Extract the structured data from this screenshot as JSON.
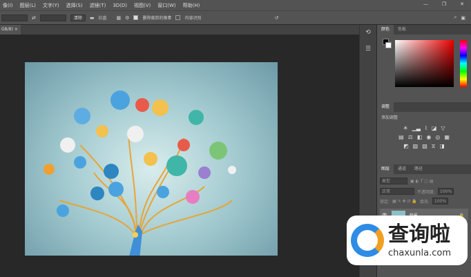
{
  "menu": [
    "像(I)",
    "图层(L)",
    "文字(Y)",
    "选择(S)",
    "滤镜(T)",
    "3D(D)",
    "视图(V)",
    "窗口(W)",
    "帮助(H)"
  ],
  "options": {
    "clear": "清除",
    "straighten": "拉直",
    "delete_cropped": "删除裁剪的像素",
    "content_aware": "内容识别"
  },
  "doc_tab": "GB/8)",
  "color_panel": {
    "tabs": [
      "颜色",
      "色板"
    ]
  },
  "adjust_panel": {
    "tab": "调整",
    "add_label": "添加调整"
  },
  "layers_panel": {
    "tabs": [
      "图层",
      "通道",
      "路径"
    ],
    "search": "类型",
    "blend": "正常",
    "opacity_label": "不透明度:",
    "opacity": "100%",
    "lock_label": "锁定:",
    "fill_label": "填充:",
    "fill": "100%",
    "layer_name": "背景"
  },
  "watermark": {
    "name": "查询啦",
    "url": "chaxunla.com"
  }
}
